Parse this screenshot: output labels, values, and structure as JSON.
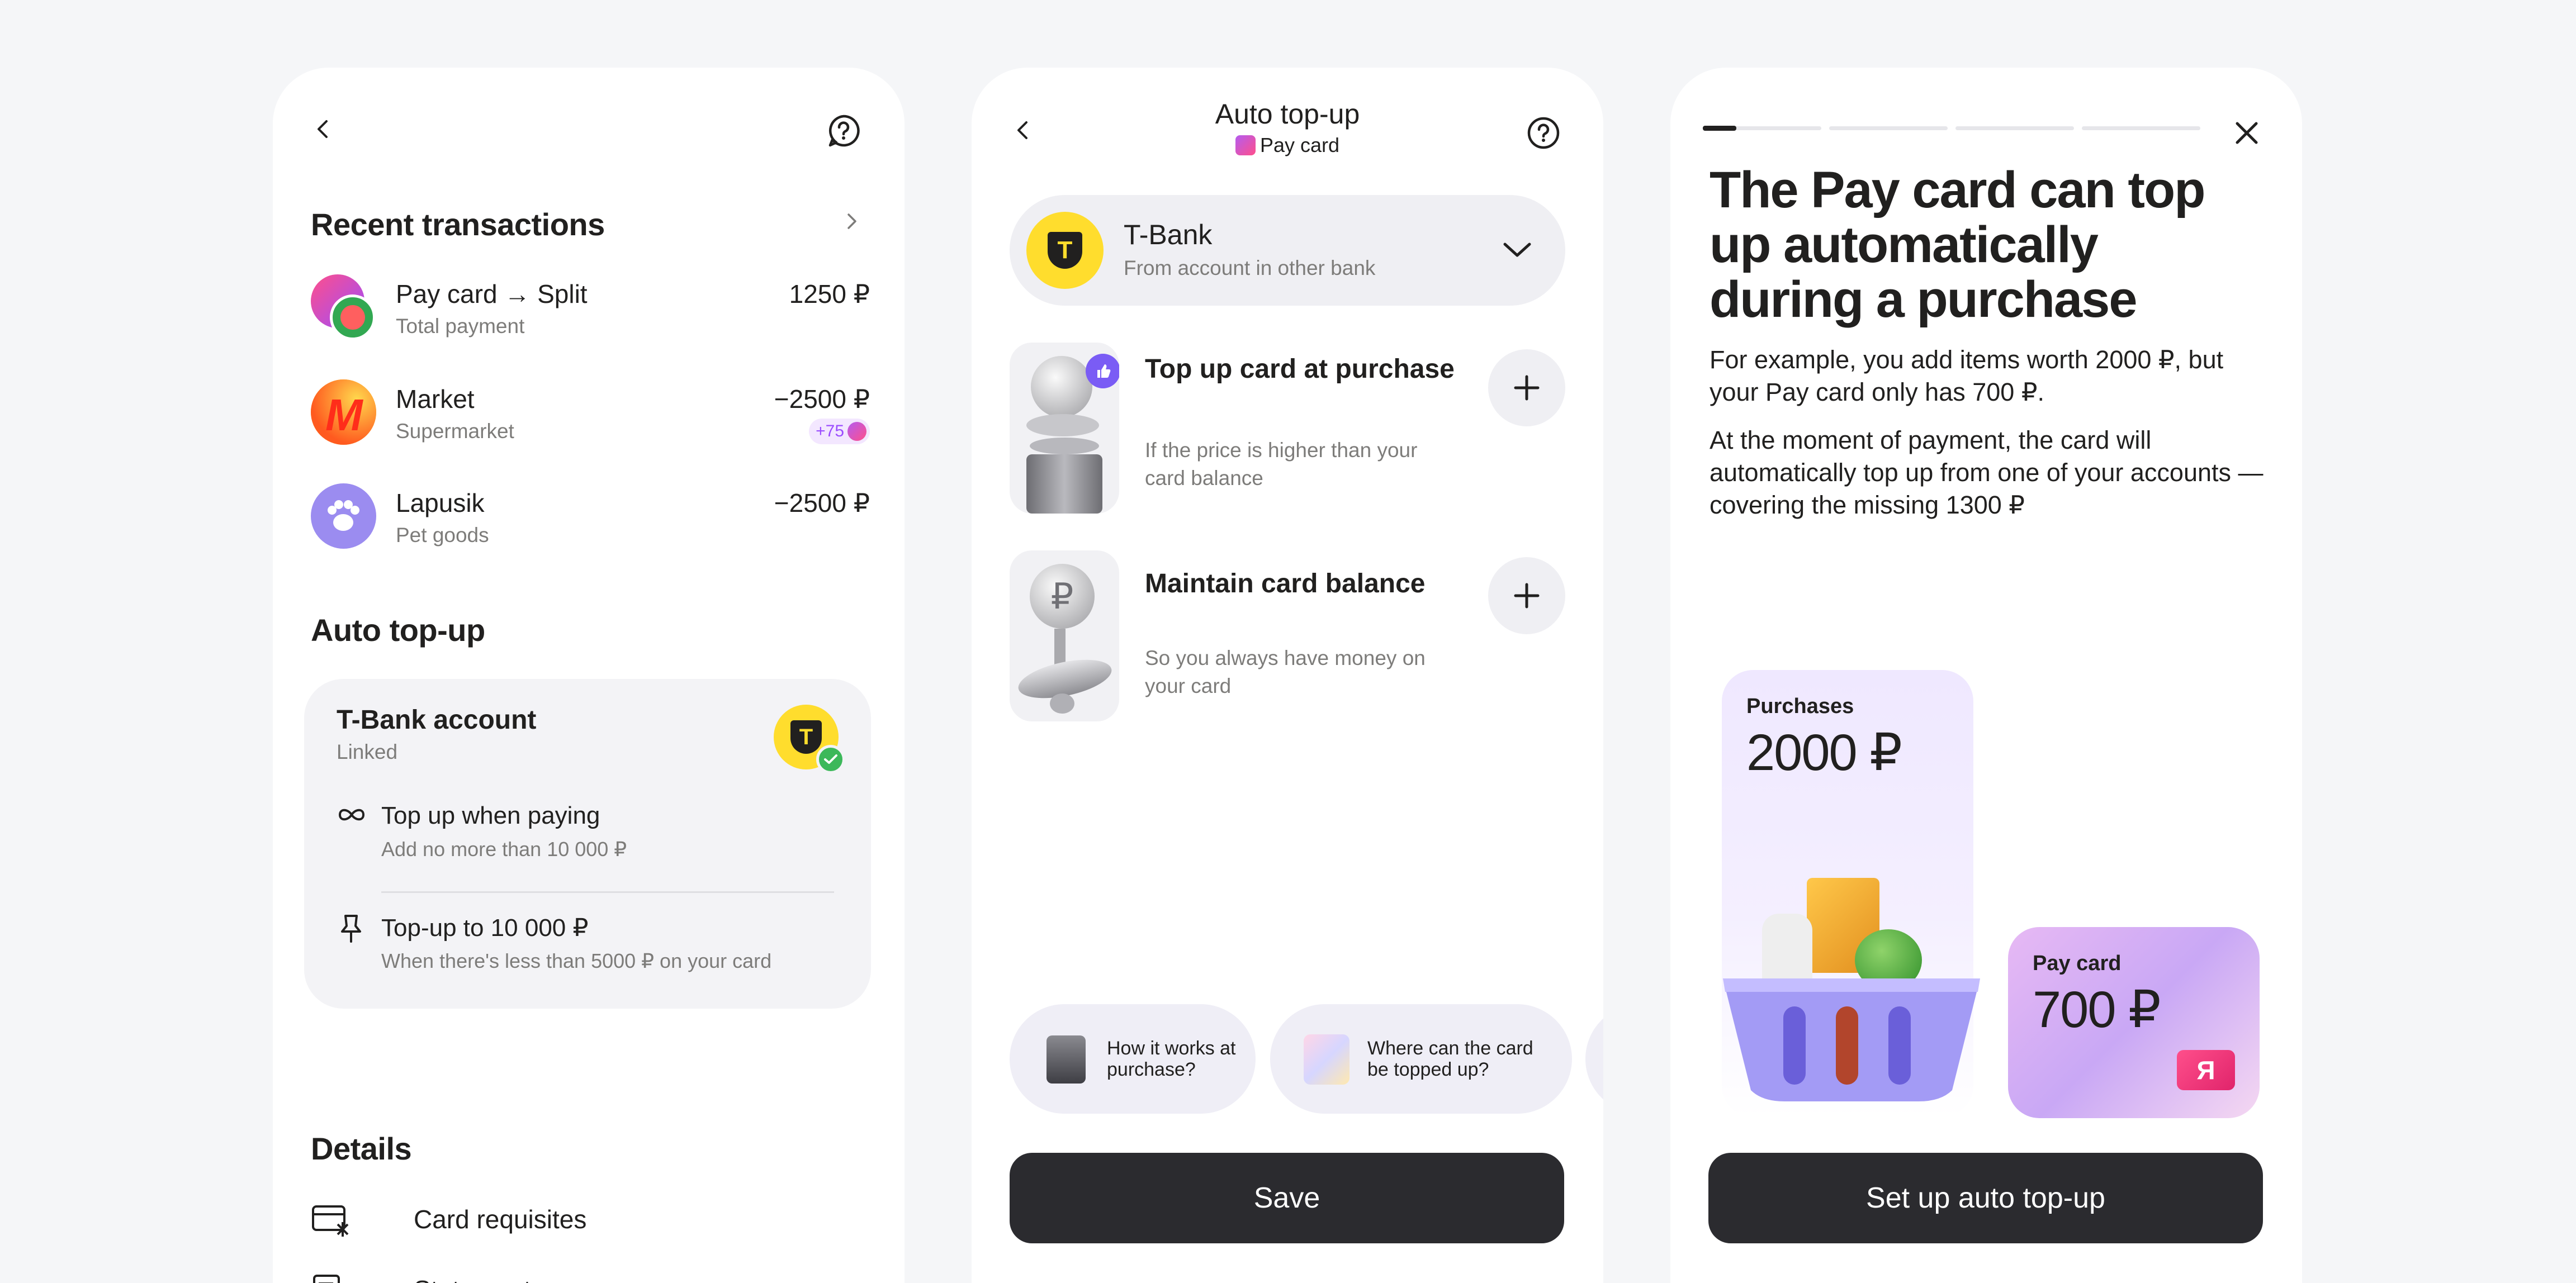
{
  "screen1": {
    "recent": {
      "title": "Recent transactions",
      "items": [
        {
          "title": "Pay card → Split",
          "subtitle": "Total payment",
          "amount": "1250 ₽"
        },
        {
          "title": "Market",
          "subtitle": "Supermarket",
          "amount": "−2500 ₽",
          "badge": "+75"
        },
        {
          "title": "Lapusik",
          "subtitle": "Pet goods",
          "amount": "−2500 ₽"
        }
      ]
    },
    "auto_topup": {
      "title": "Auto top-up",
      "account_title": "T-Bank account",
      "account_status": "Linked",
      "bank_logo": "T",
      "option1_title": "Top up when paying",
      "option1_sub": "Add no more than 10 000 ₽",
      "option2_title": "Top-up to 10 000 ₽",
      "option2_sub": "When there's less than 5000 ₽ on your card"
    },
    "details": {
      "title": "Details",
      "items": [
        {
          "label": "Card requisites",
          "icon": "card-requisites-icon"
        },
        {
          "label": "Statements",
          "icon": "statements-icon"
        }
      ]
    }
  },
  "screen2": {
    "header_title": "Auto top-up",
    "header_subtitle": "Pay card",
    "bank": {
      "logo": "T",
      "name": "T-Bank",
      "description": "From account in other bank"
    },
    "options": [
      {
        "title": "Top up card at purchase",
        "subtitle": "If the price is higher than your card balance"
      },
      {
        "title": "Maintain card balance",
        "subtitle": "So you always have money on your card"
      }
    ],
    "chips": [
      {
        "label": "How it works at purchase?"
      },
      {
        "label": "Where can the card be topped up?"
      }
    ],
    "save_label": "Save"
  },
  "screen3": {
    "headline": "The Pay card can top up automatically during a purchase",
    "para1": "For example, you add items worth 2000 ₽, but your Pay card only has 700 ₽.",
    "para2": "At the moment of payment, the card will automatically top up from one of your accounts — covering the missing 1300 ₽",
    "purchases_label": "Purchases",
    "purchases_amount": "2000 ₽",
    "paycard_label": "Pay card",
    "paycard_amount": "700 ₽",
    "paycard_logo": "Я",
    "cta_label": "Set up auto top-up",
    "progress_steps": 4,
    "progress_active": 0
  },
  "colors": {
    "dark_button": "#2b2b2f",
    "tbank_yellow": "#ffdd2d",
    "plus_badge": "#b45cf0",
    "success_green": "#3cb85a",
    "chip_bg": "#efeef6"
  }
}
